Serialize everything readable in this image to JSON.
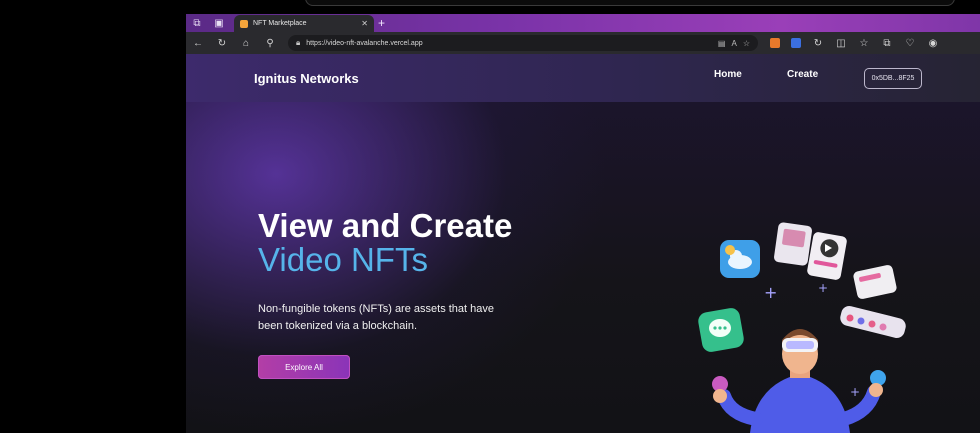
{
  "browser": {
    "tab_title": "NFT Marketplace",
    "url": "https://video-nft-avalanche.vercel.app"
  },
  "site": {
    "brand": "Ignitus Networks",
    "nav": {
      "home": "Home",
      "create": "Create"
    },
    "wallet": "0x5DB...8F25"
  },
  "hero": {
    "title_line1": "View and Create",
    "title_line2": "Video NFTs",
    "description": "Non-fungible tokens (NFTs) are assets that have been tokenized via a blockchain.",
    "cta_label": "Explore All"
  },
  "colors": {
    "accent_blue": "#56b4ea",
    "cta_pink": "#b33ea6",
    "tabstrip_purple": "#7a33a8"
  }
}
